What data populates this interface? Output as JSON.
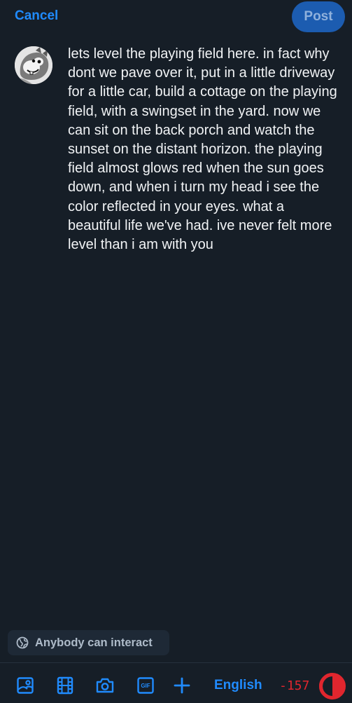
{
  "header": {
    "cancel_label": "Cancel",
    "post_label": "Post"
  },
  "composer": {
    "avatar": "squirrel-cartoon-avatar",
    "text": "lets level the playing field here. in fact why dont we pave over it, put in a little driveway for a little car, build a cottage on the playing field, with a swingset in the yard. now we can sit on the back porch and watch the sunset on the distant horizon. the playing field almost glows red when the sun goes down, and when i turn my head i see the color reflected in your eyes. what a beautiful life we've had. ive never felt more level than i am with you"
  },
  "interaction_setting": {
    "icon": "globe-icon",
    "label": "Anybody can interact"
  },
  "toolbar": {
    "tools": [
      {
        "name": "image-icon"
      },
      {
        "name": "video-icon"
      },
      {
        "name": "camera-icon"
      },
      {
        "name": "gif-icon"
      },
      {
        "name": "plus-icon"
      }
    ],
    "gif_text": "GIF",
    "language_label": "English",
    "char_count": "-157",
    "progress_fraction": 1.0
  },
  "colors": {
    "background": "#161e27",
    "accent": "#208bfe",
    "post_button": "#1c5cb0",
    "danger": "#e0262e"
  }
}
